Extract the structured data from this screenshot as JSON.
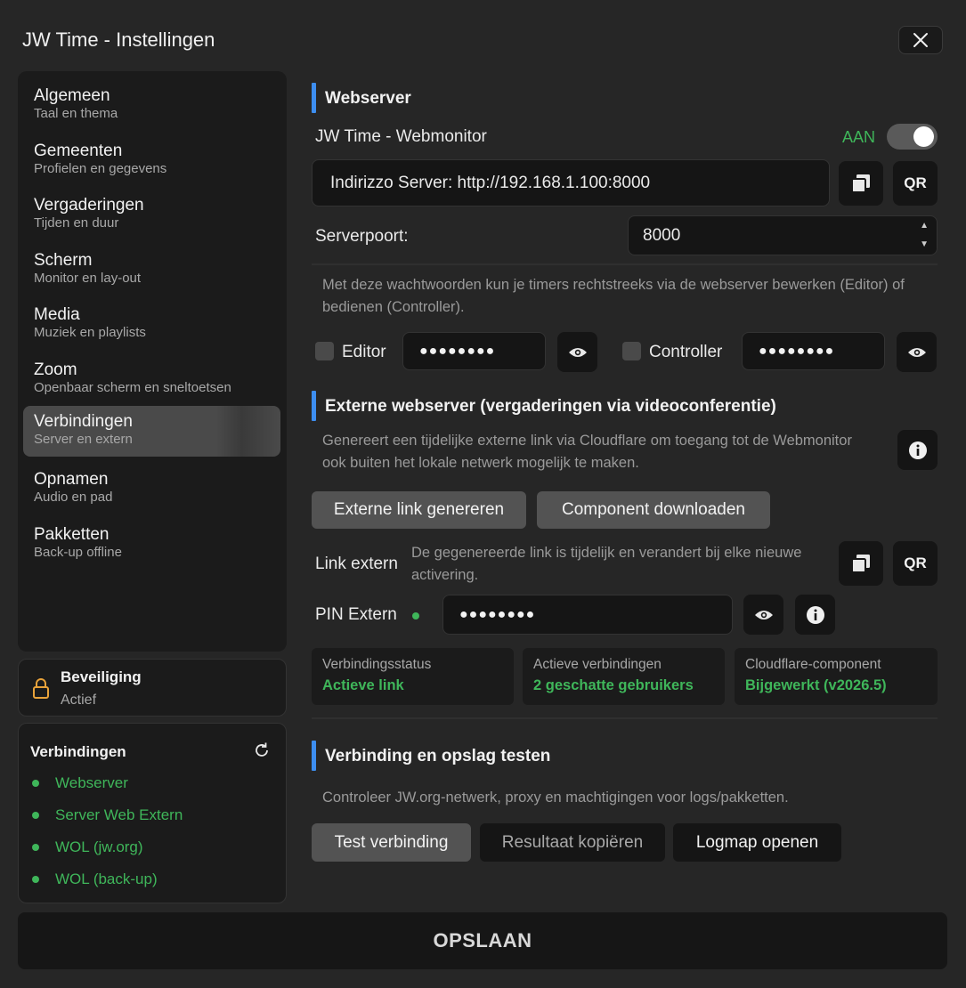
{
  "window": {
    "title": "JW Time - Instellingen"
  },
  "sidebar": {
    "items": [
      {
        "label": "Algemeen",
        "sub": "Taal en thema"
      },
      {
        "label": "Gemeenten",
        "sub": "Profielen en gegevens"
      },
      {
        "label": "Vergaderingen",
        "sub": "Tijden en duur"
      },
      {
        "label": "Scherm",
        "sub": "Monitor en lay-out"
      },
      {
        "label": "Media",
        "sub": "Muziek en playlists"
      },
      {
        "label": "Zoom",
        "sub": "Openbaar scherm en sneltoetsen"
      },
      {
        "label": "Verbindingen",
        "sub": "Server en extern"
      },
      {
        "label": "Opnamen",
        "sub": "Audio en pad"
      },
      {
        "label": "Pakketten",
        "sub": "Back-up offline"
      }
    ],
    "active_index": 6
  },
  "security": {
    "title": "Beveiliging",
    "status": "Actief"
  },
  "connections": {
    "title": "Verbindingen",
    "items": [
      "Webserver",
      "Server Web Extern",
      "WOL (jw.org)",
      "WOL (back-up)"
    ]
  },
  "webserver": {
    "section_title": "Webserver",
    "monitor_label": "JW Time - Webmonitor",
    "toggle_state": "AAN",
    "address": "Indirizzo Server: http://192.168.1.100:8000",
    "qr_label": "QR",
    "port_label": "Serverpoort:",
    "port_value": "8000",
    "password_help": "Met deze wachtwoorden kun je timers rechtstreeks via de webserver bewerken (Editor) of bedienen (Controller).",
    "editor_label": "Editor",
    "editor_password": "●●●●●●●●",
    "controller_label": "Controller",
    "controller_password": "●●●●●●●●"
  },
  "external": {
    "section_title": "Externe webserver (vergaderingen via videoconferentie)",
    "description": "Genereert een tijdelijke externe link via Cloudflare om toegang tot de Webmonitor ook buiten het lokale netwerk mogelijk te maken.",
    "generate_button": "Externe link genereren",
    "download_button": "Component downloaden",
    "link_label": "Link extern",
    "link_note": "De gegenereerde link is tijdelijk en verandert bij elke nieuwe activering.",
    "qr_label": "QR",
    "pin_label": "PIN Extern",
    "pin_value": "●●●●●●●●",
    "stats": [
      {
        "label": "Verbindingsstatus",
        "value": "Actieve link"
      },
      {
        "label": "Actieve verbindingen",
        "value": "2 geschatte gebruikers"
      },
      {
        "label": "Cloudflare-component",
        "value": "Bijgewerkt (v2026.5)"
      }
    ]
  },
  "test": {
    "section_title": "Verbinding en opslag testen",
    "description": "Controleer JW.org-netwerk, proxy en machtigingen voor logs/pakketten.",
    "test_button": "Test verbinding",
    "copy_button": "Resultaat kopiëren",
    "logfolder_button": "Logmap openen"
  },
  "footer": {
    "save_label": "OPSLAAN"
  },
  "colors": {
    "accent": "#3d8ef0",
    "success": "#3fb65a",
    "background": "#262626"
  },
  "icons": [
    "close-icon",
    "copy-icon",
    "eye-icon",
    "info-icon",
    "lock-icon",
    "refresh-icon",
    "spinner-up-icon",
    "spinner-down-icon"
  ]
}
